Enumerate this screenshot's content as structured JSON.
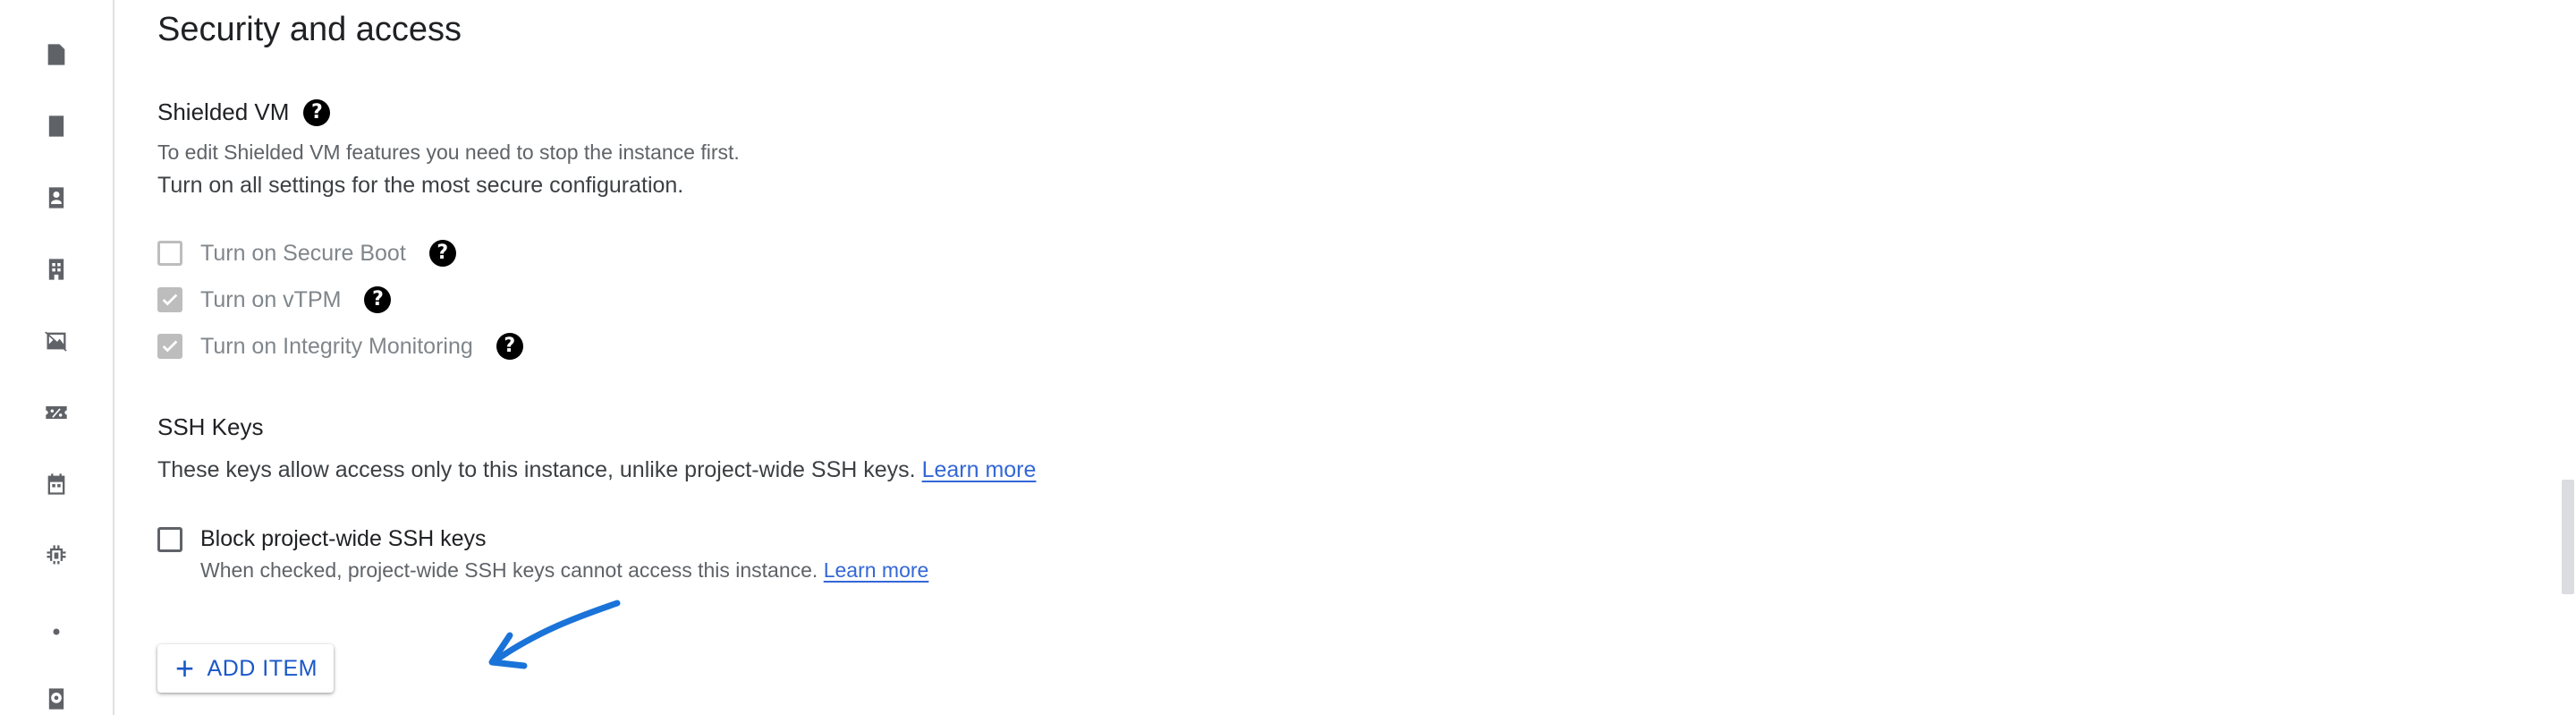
{
  "rail_icons": [
    "file-icon",
    "book-icon",
    "person-card-icon",
    "building-icon",
    "image-off-icon",
    "discount-icon",
    "calendar-icon",
    "chip-icon",
    "dot-icon",
    "disk-icon"
  ],
  "section": {
    "title": "Security and access"
  },
  "shielded_vm": {
    "title": "Shielded VM",
    "help_glyph": "?",
    "note": "To edit Shielded VM features you need to stop the instance first.",
    "hint": "Turn on all settings for the most secure configuration.",
    "options": [
      {
        "label": "Turn on Secure Boot",
        "checked": false
      },
      {
        "label": "Turn on vTPM",
        "checked": true
      },
      {
        "label": "Turn on Integrity Monitoring",
        "checked": true
      }
    ]
  },
  "ssh_keys": {
    "title": "SSH Keys",
    "description": "These keys allow access only to this instance, unlike project-wide SSH keys.",
    "learn_more": "Learn more",
    "block_label": "Block project-wide SSH keys",
    "block_checked": false,
    "block_hint": "When checked, project-wide SSH keys cannot access this instance.",
    "block_learn_more": "Learn more",
    "add_item_label": "ADD ITEM",
    "add_item_icon": "+"
  },
  "colors": {
    "link": "#3367d6",
    "annotation_arrow": "#1a73d8",
    "button_text": "#1a57c9"
  }
}
